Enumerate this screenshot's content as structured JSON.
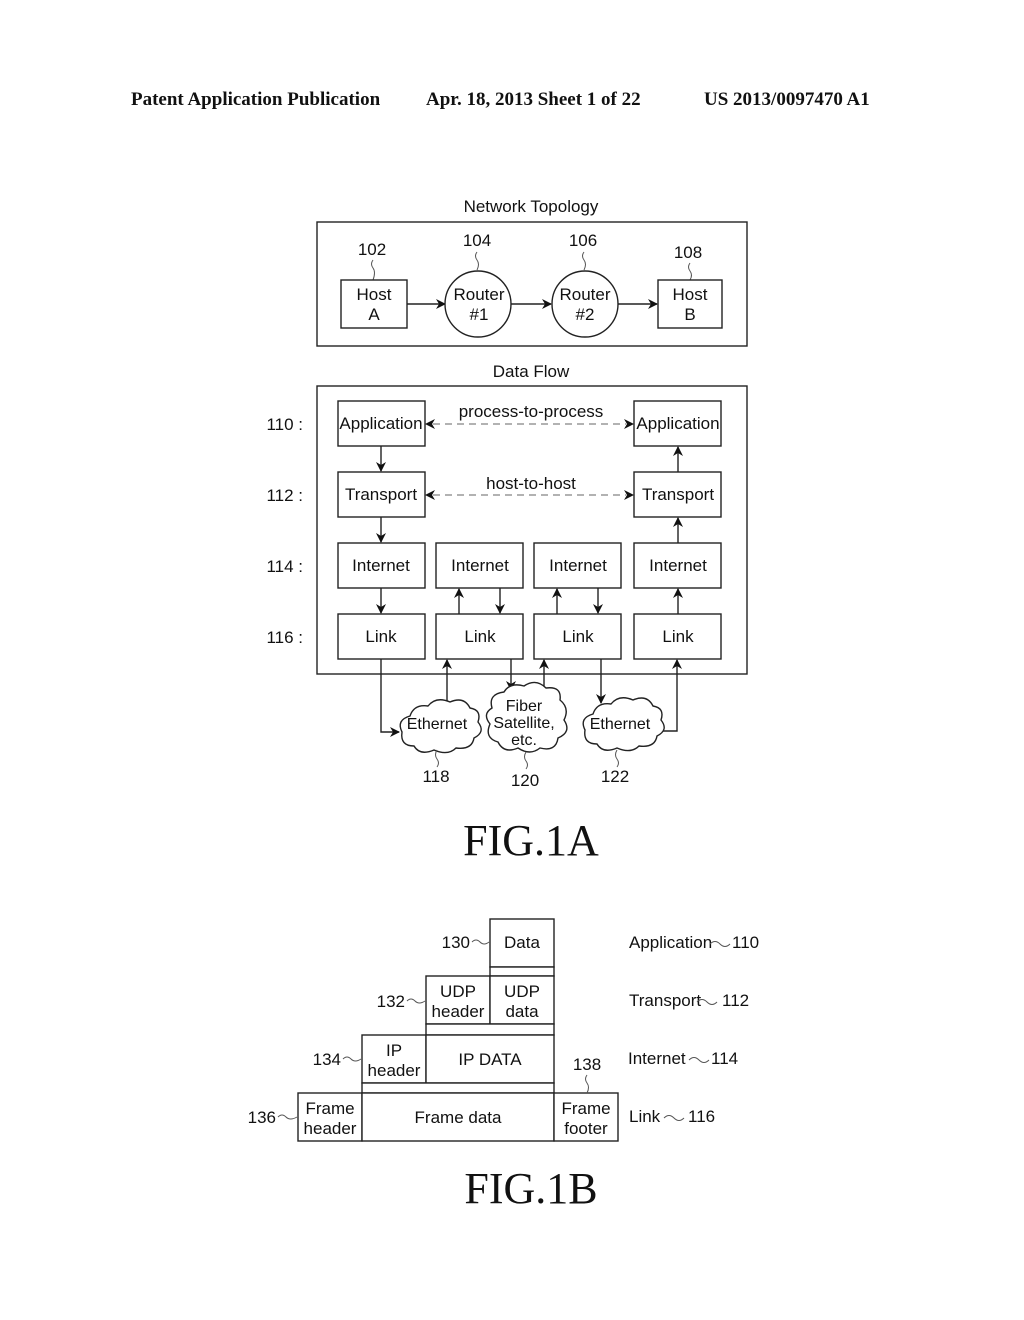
{
  "header": {
    "publication": "Patent Application Publication",
    "date_sheet": "Apr. 18, 2013  Sheet 1 of 22",
    "number": "US 2013/0097470 A1"
  },
  "fig1a": {
    "topology_title": "Network Topology",
    "nodes": [
      {
        "ref": "102",
        "line1": "Host",
        "line2": "A"
      },
      {
        "ref": "104",
        "line1": "Router",
        "line2": "#1"
      },
      {
        "ref": "106",
        "line1": "Router",
        "line2": "#2"
      },
      {
        "ref": "108",
        "line1": "Host",
        "line2": "B"
      }
    ],
    "dataflow_title": "Data Flow",
    "layer_refs": [
      "110 :",
      "112 :",
      "114 :",
      "116 :"
    ],
    "layers": {
      "application": "Application",
      "transport": "Transport",
      "internet": "Internet",
      "link": "Link"
    },
    "process_to_process": "process-to-process",
    "host_to_host": "host-to-host",
    "clouds": [
      {
        "ref": "118",
        "lines": [
          "Ethernet"
        ]
      },
      {
        "ref": "120",
        "lines": [
          "Fiber",
          "Satellite,",
          "etc."
        ]
      },
      {
        "ref": "122",
        "lines": [
          "Ethernet"
        ]
      }
    ],
    "caption": "FIG.1A"
  },
  "fig1b": {
    "data": {
      "ref": "130",
      "label": "Data"
    },
    "udp_header": {
      "ref": "132",
      "line1": "UDP",
      "line2": "header"
    },
    "udp_data": {
      "line1": "UDP",
      "line2": "data"
    },
    "ip_header": {
      "ref": "134",
      "line1": "IP",
      "line2": "header"
    },
    "ip_data": "IP DATA",
    "frame_header": {
      "ref": "136",
      "line1": "Frame",
      "line2": "header"
    },
    "frame_data": "Frame data",
    "frame_footer": {
      "ref": "138",
      "line1": "Frame",
      "line2": "footer"
    },
    "layer_labels": [
      {
        "name": "Application",
        "ref": "110"
      },
      {
        "name": "Transport",
        "ref": "112"
      },
      {
        "name": "Internet",
        "ref": "114"
      },
      {
        "name": "Link",
        "ref": "116"
      }
    ],
    "caption": "FIG.1B"
  }
}
